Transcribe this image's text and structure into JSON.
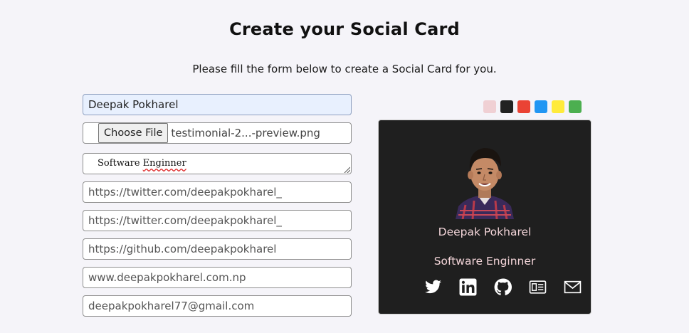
{
  "page": {
    "title": "Create your Social Card",
    "subtitle": "Please fill the form below to create a Social Card for you."
  },
  "form": {
    "name_value": "Deepak Pokharel",
    "file_button_label": "Choose File",
    "file_name": "testimonial-2...-preview.png",
    "title_value_prefix": "Software ",
    "title_value_misspelled": "Enginner",
    "twitter_value": "https://twitter.com/deepakpokharel_",
    "linkedin_value": "https://twitter.com/deepakpokharel_",
    "github_value": "https://github.com/deepakpokharel",
    "website_value": "www.deepakpokharel.com.np",
    "email_value": "deepakpokharel77@gmail.com"
  },
  "theme_colors": [
    "#f0d0d4",
    "#222222",
    "#ea4335",
    "#2196f3",
    "#ffeb3b",
    "#4caf50"
  ],
  "card": {
    "name": "Deepak Pokharel",
    "title": "Software Enginner",
    "background": "#1f1f1f",
    "text_color": "#f2d4d8",
    "icons": [
      "twitter-icon",
      "linkedin-icon",
      "github-icon",
      "website-icon",
      "email-icon"
    ]
  }
}
